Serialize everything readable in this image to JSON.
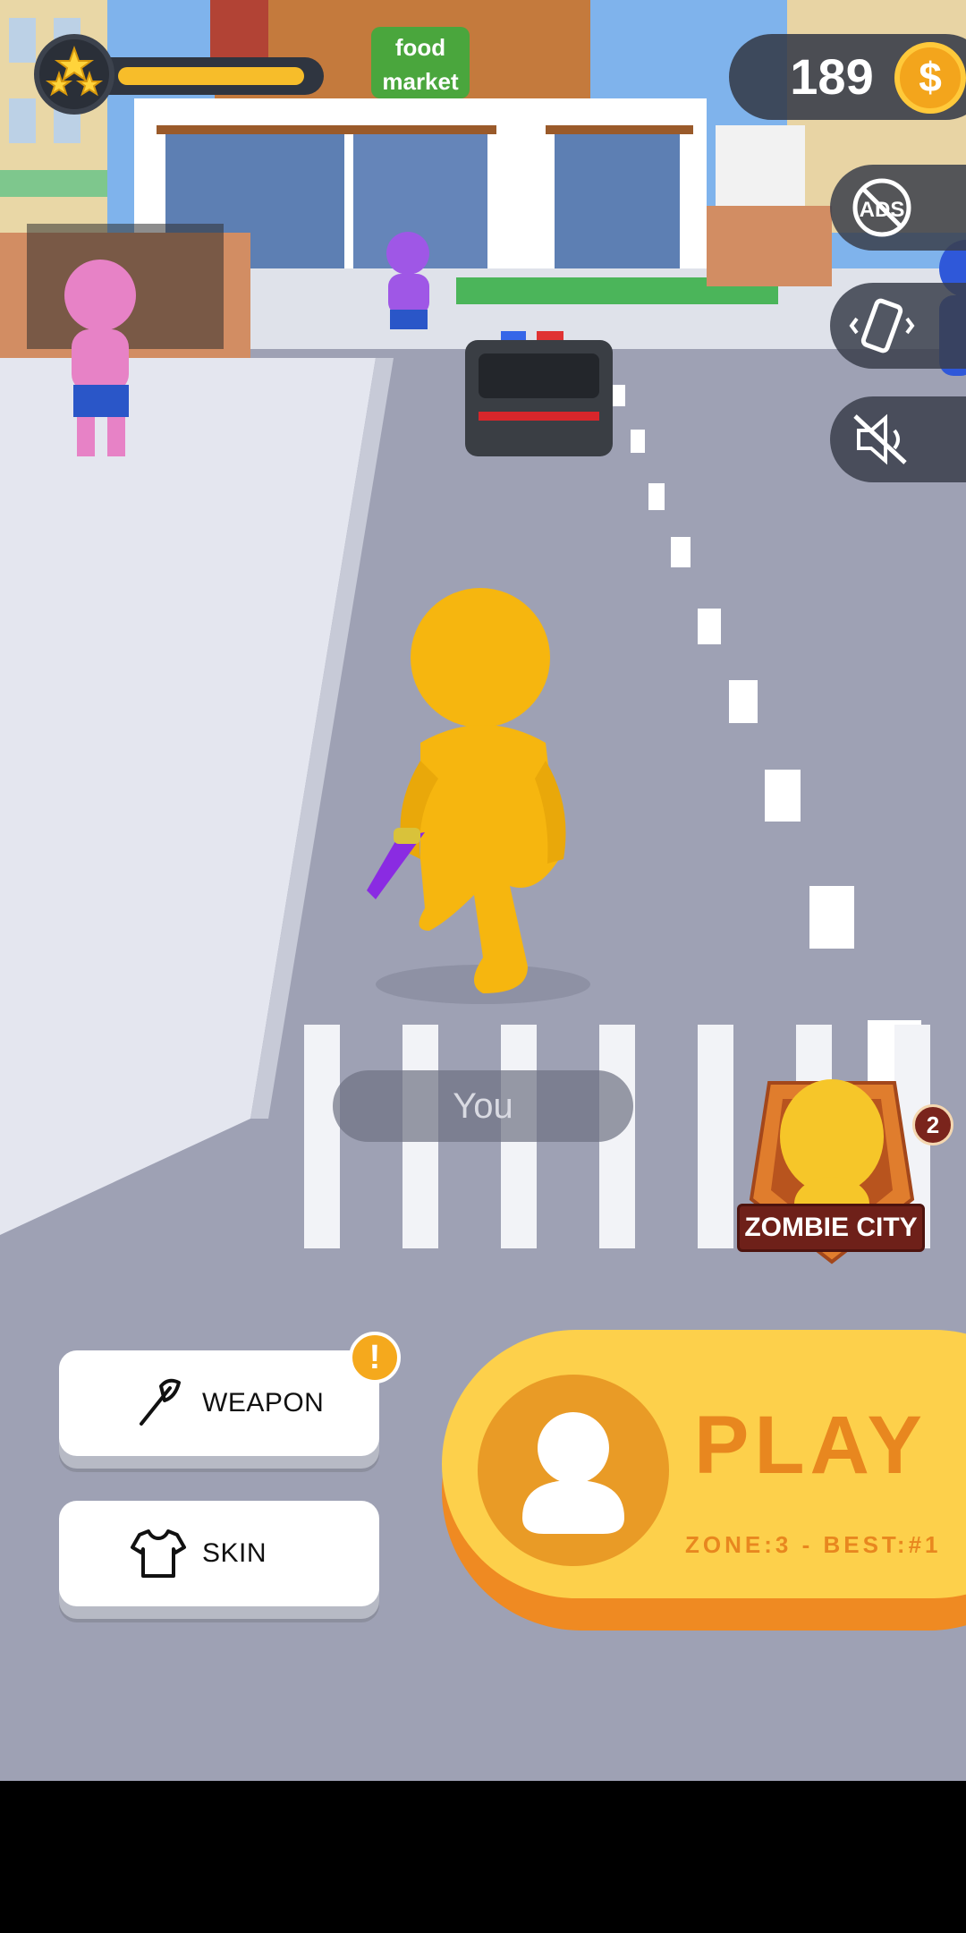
{
  "hud": {
    "level_icon": "stars-icon",
    "level_progress": 0.88,
    "coins": "189",
    "coin_symbol": "$"
  },
  "scene": {
    "store_sign": "food market",
    "player_label": "You"
  },
  "side_buttons": [
    {
      "name": "remove-ads",
      "icon": "no-ads-icon"
    },
    {
      "name": "vibration",
      "icon": "vibration-icon"
    },
    {
      "name": "sound",
      "icon": "sound-muted-icon"
    }
  ],
  "zone_badge": {
    "title": "ZOMBIE CITY",
    "rank": "2"
  },
  "menu": {
    "weapon_label": "WEAPON",
    "weapon_alert": "!",
    "skin_label": "SKIN"
  },
  "play": {
    "label": "PLAY",
    "subtitle": "ZONE:3  -  BEST:#1"
  },
  "colors": {
    "accent": "#fdd04b",
    "accent_dark": "#e8871f",
    "player": "#f6b60f"
  }
}
